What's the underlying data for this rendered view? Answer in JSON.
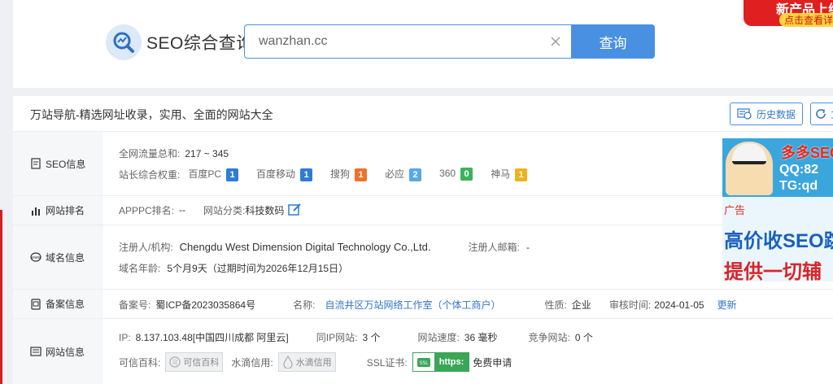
{
  "header": {
    "logo_text": "SEO综合查询",
    "search_value": "wanzhan.cc",
    "search_button": "查询",
    "promo_line1": "新产品上线",
    "promo_line2": "点击查看详情"
  },
  "card": {
    "title": "万站导航-精选网址收录，实用、全面的网站大全",
    "history_button": "历史数据",
    "second_button": "立即"
  },
  "seo": {
    "label": "SEO信息",
    "traffic_label": "全网流量总和:",
    "traffic_value": "217 ~ 345",
    "weight_label": "站长综合权重:",
    "weights": [
      {
        "name": "百度PC",
        "value": "1",
        "color": "#2f7bd8"
      },
      {
        "name": "百度移动",
        "value": "1",
        "color": "#2f7bd8"
      },
      {
        "name": "搜狗",
        "value": "1",
        "color": "#f0712a"
      },
      {
        "name": "必应",
        "value": "2",
        "color": "#57a8e8"
      },
      {
        "name": "360",
        "value": "0",
        "color": "#3cb35b"
      },
      {
        "name": "神马",
        "value": "1",
        "color": "#f0b21a"
      }
    ]
  },
  "rank": {
    "label": "网站排名",
    "apppc_label": "APPPC排名:",
    "apppc_value": "--",
    "category_label": "网站分类:",
    "category_value": "科技数码"
  },
  "domain": {
    "label": "域名信息",
    "registrant_label": "注册人/机构:",
    "registrant_value": "Chengdu West Dimension Digital Technology Co.,Ltd.",
    "email_label": "注册人邮箱:",
    "email_value": "-",
    "age_label": "域名年龄:",
    "age_value": "5个月9天（过期时间为2026年12月15日）"
  },
  "icp": {
    "label": "备案信息",
    "number_label": "备案号:",
    "number_value": "蜀ICP备2023035864号",
    "name_label": "名称:",
    "name_value": "自流井区万站网络工作室（个体工商户）",
    "nature_label": "性质:",
    "nature_value": "企业",
    "review_label": "审核时间:",
    "review_value": "2024-01-05",
    "update_link": "更新"
  },
  "site": {
    "label": "网站信息",
    "ip_label": "IP:",
    "ip_value": "8.137.103.48[中国四川成都 阿里云]",
    "same_ip_label": "同IP网站:",
    "same_ip_value": "3 个",
    "speed_label": "网站速度:",
    "speed_value": "36 毫秒",
    "competitor_label": "竞争网站:",
    "competitor_value": "0 个",
    "trust_label": "可信百科:",
    "trust_chip": "可信百科",
    "didi_label": "水滴信用:",
    "didi_chip": "水滴信用",
    "ssl_label": "SSL证书:",
    "ssl_https": "https:",
    "ssl_free": "免费申请"
  },
  "ad": {
    "line1": "多多SEO",
    "line2": "QQ:82",
    "line3": "TG:qd",
    "tag": "广告",
    "line4": "高价收SEO跳",
    "line5": "提供一切辅"
  }
}
